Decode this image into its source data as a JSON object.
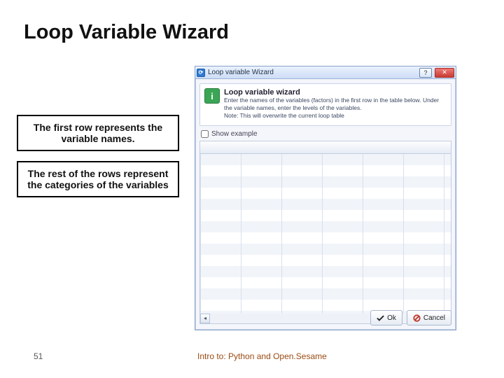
{
  "title": "Loop Variable Wizard",
  "callouts": {
    "first": "The first row represents the variable names.",
    "rest": "The rest of the rows represent the categories of the variables"
  },
  "dialog": {
    "window_title": "Loop variable Wizard",
    "header_title": "Loop variable wizard",
    "header_desc": "Enter the names of the variables (factors) in the first row in the table below. Under the variable names, enter the levels of the variables.",
    "header_note": "Note: This will overwrite the current loop table",
    "show_example_label": "Show example",
    "ok_label": "Ok",
    "cancel_label": "Cancel"
  },
  "page_number": "51",
  "footer_text": "Intro to: Python and Open.Sesame"
}
